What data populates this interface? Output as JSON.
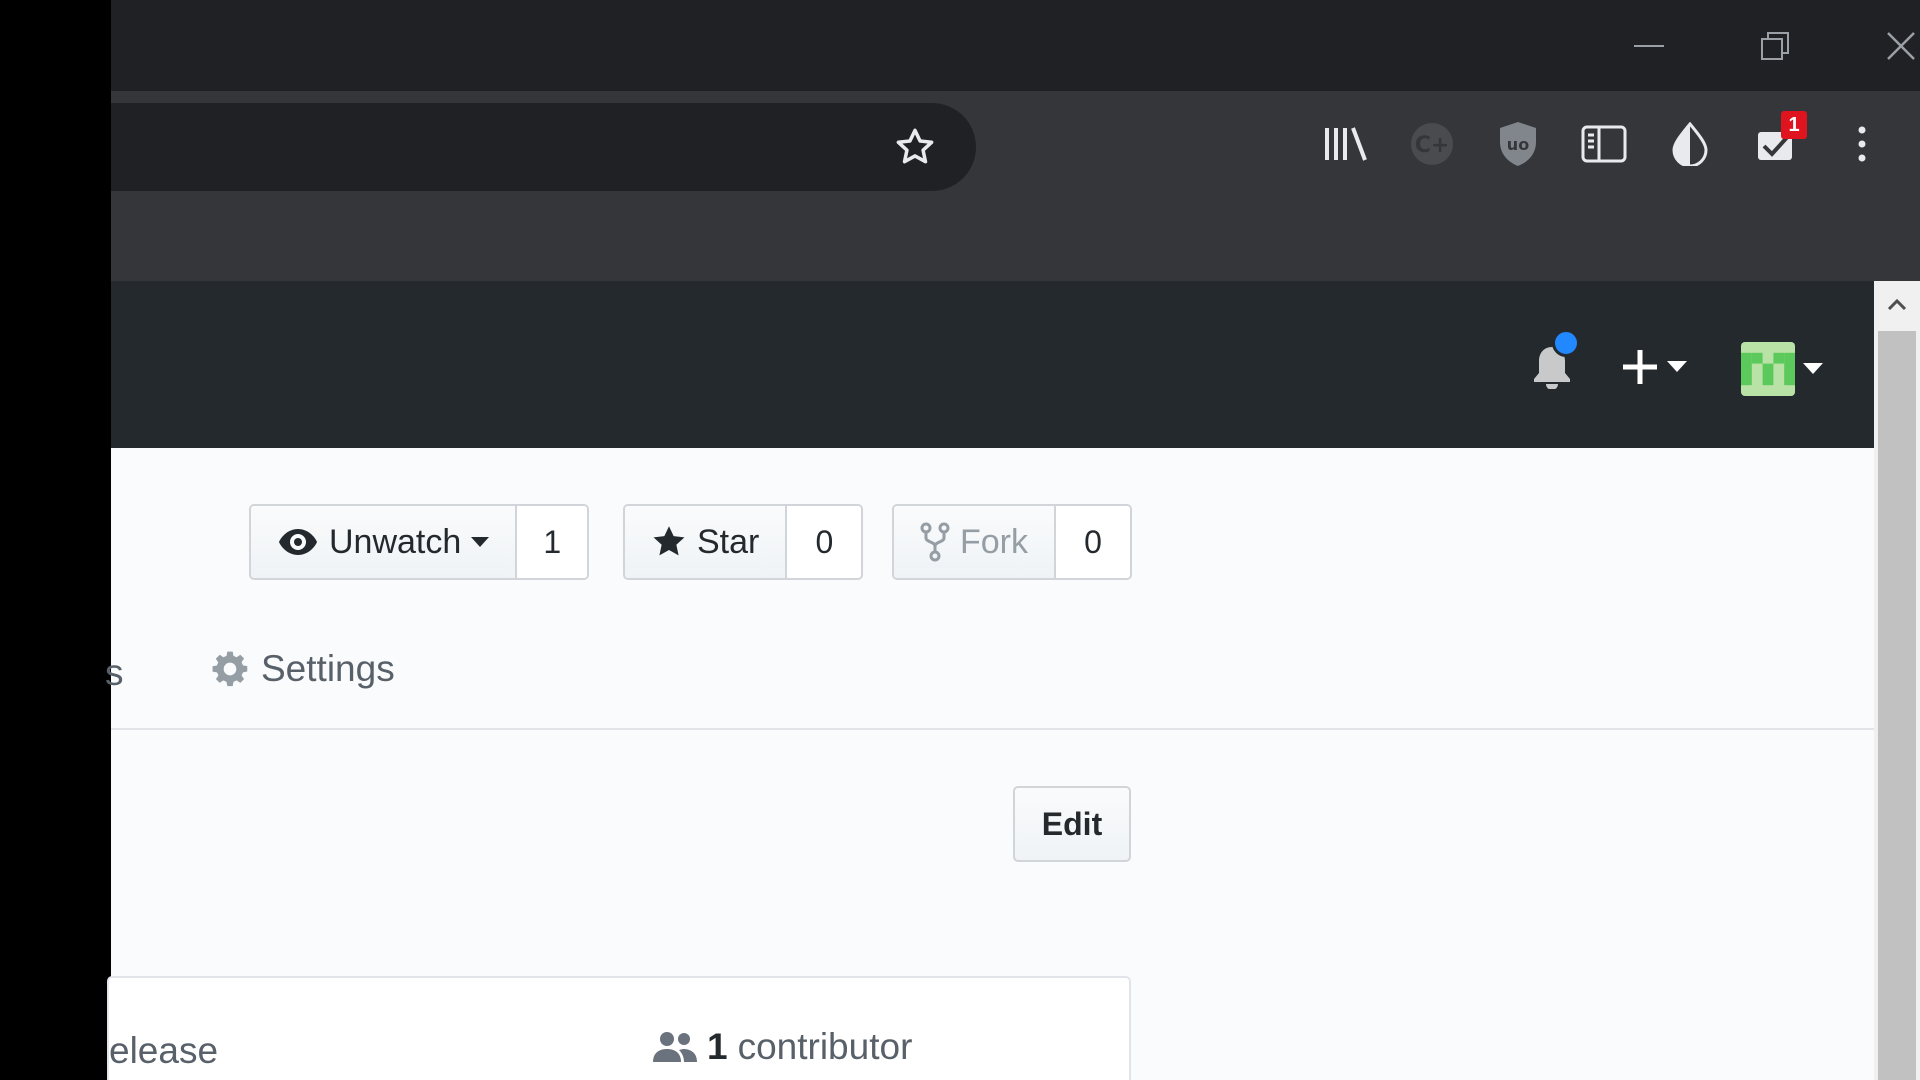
{
  "window_controls": {
    "minimize": "minimize-icon",
    "restore": "restore-icon",
    "close": "close-icon"
  },
  "browser_toolbar": {
    "bookmark_icon": "star-outline-icon",
    "extensions": [
      {
        "name": "library-icon"
      },
      {
        "name": "extension-disabled-icon"
      },
      {
        "name": "ublock-icon",
        "text": "uo"
      },
      {
        "name": "sidebar-icon"
      },
      {
        "name": "dark-reader-icon"
      },
      {
        "name": "todo-check-icon",
        "badge": "1"
      },
      {
        "name": "menu-kebab-icon"
      }
    ]
  },
  "gh_header": {
    "notification_icon": "bell-icon",
    "new_menu_icon": "plus-icon",
    "avatar_icon": "identicon-avatar"
  },
  "repo_actions": {
    "watch": {
      "label": "Unwatch",
      "count": "1"
    },
    "star": {
      "label": "Star",
      "count": "0"
    },
    "fork": {
      "label": "Fork",
      "count": "0"
    }
  },
  "nav": {
    "partial_tab": "s",
    "settings_label": "Settings"
  },
  "edit_button": "Edit",
  "summary": {
    "release_partial": "elease",
    "contributor_count": "1",
    "contributor_label": "contributor"
  },
  "colors": {
    "titlebar": "#202124",
    "toolbar": "#35363a",
    "gh_header": "#24292e",
    "page_bg": "#fafbfc",
    "badge_red": "#e0141e",
    "notif_blue": "#2188ff"
  }
}
